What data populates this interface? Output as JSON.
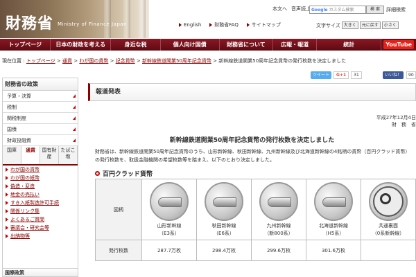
{
  "header": {
    "logo_ja": "財務省",
    "logo_en": "Ministry of Finance Japan",
    "links": [
      "本文へ",
      "音声読上"
    ],
    "search_placeholder_brand": "Google",
    "search_placeholder": "カスタム検索",
    "search_button": "検 索",
    "advanced": "詳細検索",
    "nav2": [
      {
        "label": "English"
      },
      {
        "label": "財務省FAQ"
      },
      {
        "label": "サイトマップ"
      }
    ],
    "textsize_label": "文字サイズ",
    "textsize_buttons": [
      "大きく",
      "元に戻す",
      "小さく"
    ]
  },
  "mainnav": [
    "トップページ",
    "日本の財政を考える",
    "身近な税",
    "個人向け国債",
    "財務省について",
    "広報・報道",
    "統計"
  ],
  "youtube": "YouTube",
  "breadcrumb": {
    "prefix": "現在位置 : ",
    "items": [
      "トップページ",
      "通貨",
      "わが国の貨幣",
      "記念貨幣",
      "新幹線鉄道開業50周年記念貨幣"
    ],
    "current": "新幹線鉄道開業50周年記念貨幣の発行枚数を決定しました"
  },
  "social": {
    "tweet": "ツイート",
    "gplus": "G+1",
    "gcount": "31",
    "fb": "いいね！",
    "fbcount": "90"
  },
  "sidebar": {
    "title": "財務省の政策",
    "items": [
      "予算・決算",
      "税制",
      "関税制度",
      "国債",
      "財政投融資"
    ],
    "tabs": [
      "国庫",
      "通貨",
      "国有財産",
      "たばこ塩"
    ],
    "sublinks": [
      "わが国の貨幣",
      "わが国の紙幣",
      "偽造・変造",
      "地金の売払い",
      "すき入紙製造許可手続",
      "関係リンク集",
      "よくあるご質問",
      "審議会・研究会等",
      "出納物等"
    ],
    "bottom": "国際政策"
  },
  "main": {
    "title": "報道発表",
    "date": "平成27年12月4日",
    "ministry": "財　務　省",
    "heading": "新幹線鉄道開業50周年記念貨幣の発行枚数を決定しました",
    "body": "財務省は、新幹線鉄道開業50周年記念貨幣のうち、山形新幹線、秋田新幹線、九州新幹線及び北海道新幹線の4銘柄の貨幣（百円クラッド貨幣）の発行枚数を、取扱金融機関の希望枚数等を踏まえ、以下のとおり決定しました。",
    "subheading": "百円クラッド貨幣",
    "row_label": "図柄",
    "row2_label": "発行枚数",
    "coins": [
      {
        "name": "山形新幹線",
        "sub": "（E3系）",
        "count": "287.7万枚"
      },
      {
        "name": "秋田新幹線",
        "sub": "（E6系）",
        "count": "298.4万枚"
      },
      {
        "name": "九州新幹線",
        "sub": "（新800系）",
        "count": "299.6万枚"
      },
      {
        "name": "北海道新幹線",
        "sub": "（H5系）",
        "count": "301.6万枚"
      },
      {
        "name": "共通裏面",
        "sub": "（0系新幹線）",
        "count": ""
      }
    ]
  }
}
